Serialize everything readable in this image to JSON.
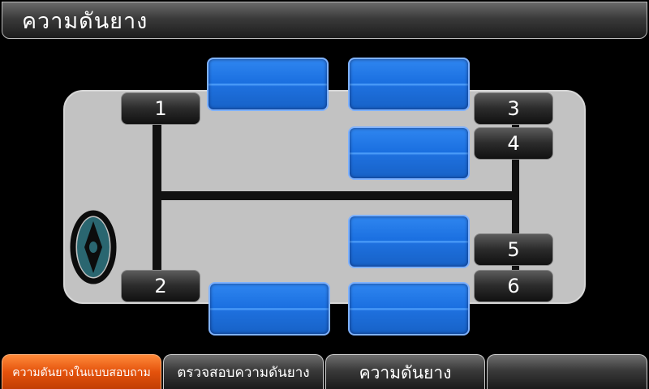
{
  "header": {
    "title": "ความดันยาง"
  },
  "wheels": {
    "w1": "1",
    "w2": "2",
    "w3": "3",
    "w4": "4",
    "w5": "5",
    "w6": "6"
  },
  "tabs": [
    {
      "label": "ความดันยางในแบบสอบถาม",
      "active": true
    },
    {
      "label": "ตรวจสอบความดันยาง",
      "active": false
    },
    {
      "label": "ความดันยาง",
      "active": false
    },
    {
      "label": "",
      "active": false
    }
  ],
  "colors": {
    "panel": "#1a6fe0",
    "active_tab": "#e4520c",
    "car_body": "#c2c2c2",
    "steering_wheel": "#2a6670"
  }
}
